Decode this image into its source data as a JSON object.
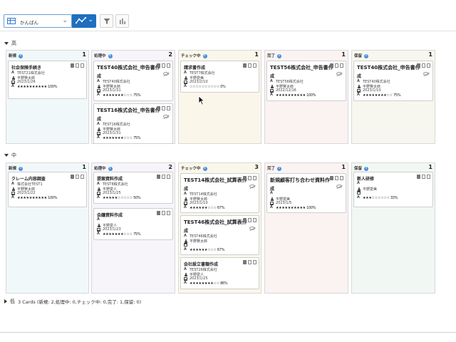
{
  "toolbar": {
    "view_label": "かんばん",
    "icons": [
      "board-icon",
      "line-chart-icon",
      "filter-icon",
      "bar-chart-icon"
    ]
  },
  "groups": [
    {
      "label": "高",
      "expanded": true,
      "columns": [
        {
          "title": "新規",
          "count": "1",
          "bg": "#f1f8f9",
          "cards": [
            {
              "title": "社会保険手続き",
              "lines": [
                "TEST21株式会社",
                "平野賢太郎",
                "2023/1/26"
              ],
              "rating": "★★★★★★★★★★ 100%"
            }
          ]
        },
        {
          "title": "処理中",
          "count": "2",
          "bg": "#f7f4fa",
          "cards": [
            {
              "title": "TEST40株式会社_申告書作",
              "title2": "成",
              "lines": [
                "TEST40株式会社",
                "平野賢太郎",
                "2023/1/31"
              ],
              "rating": "★★★★★★★☆☆☆ 75%"
            },
            {
              "title": "TEST16株式会社_申告書作",
              "title2": "成",
              "lines": [
                "TEST16株式会社",
                "平野賢太郎",
                "2023/1/31"
              ],
              "rating": "★★★★★★★☆☆☆ 75%"
            }
          ]
        },
        {
          "title": "チェック中",
          "count": "1",
          "bg": "#faf7ea",
          "cards": [
            {
              "title": "請求書作成",
              "lines": [
                "TEST7株式会社",
                "平野愛美",
                "2023/2/10"
              ],
              "rating": "☆☆☆☆☆☆☆☆☆☆ 0%"
            }
          ]
        },
        {
          "title": "完了",
          "count": "1",
          "bg": "#fbf2f2",
          "cards": [
            {
              "title": "TEST56株式会社_申告書作",
              "title2": "成",
              "lines": [
                "TEST56株式会社",
                "平野賢太郎",
                "2022/12/16"
              ],
              "rating": "★★★★★★★★★★ 100%"
            }
          ]
        },
        {
          "title": "保留",
          "count": "1",
          "bg": "#f7f7f0",
          "cards": [
            {
              "title": "TEST40株式会社_申告書作",
              "title2": "成",
              "lines": [
                "TEST40株式会社",
                "平野賢太郎",
                "2023/1/10"
              ],
              "rating": "★★★★★★★★☆☆ 75%"
            }
          ]
        }
      ]
    },
    {
      "label": "中",
      "expanded": true,
      "columns": [
        {
          "title": "新規",
          "count": "1",
          "bg": "#f1f8f9",
          "cards": [
            {
              "title": "クレーム内容調査",
              "lines": [
                "株式会社TEST1",
                "平野賢太郎",
                "2023/1/22"
              ],
              "rating": "★★★★★★★★★★ 100%"
            }
          ]
        },
        {
          "title": "処理中",
          "count": "2",
          "bg": "#f7f4fa",
          "cards": [
            {
              "title": "提案資料作成",
              "lines": [
                "TEST8株式会社",
                "平野愛人",
                "2023/1/25"
              ],
              "rating": "★★★★★☆☆☆☆☆ 50%"
            },
            {
              "title": "会議資料作成",
              "lines": [
                "",
                "平野愛人",
                "2023/1/23"
              ],
              "rating": "★★★★★★★☆☆☆ 75%"
            }
          ]
        },
        {
          "title": "チェック中",
          "count": "3",
          "bg": "#faf7ea",
          "cards": [
            {
              "title": "TEST14株式会社_試算表作",
              "title2": "成",
              "lines": [
                "TEST14株式会社",
                "平野賢太郎",
                "2023/1/10"
              ],
              "rating": "★★★★★★☆☆☆ 67%"
            },
            {
              "title": "TEST46株式会社_試算表作",
              "title2": "成",
              "lines": [
                "TEST46株式会社",
                "平野賢太郎",
                ""
              ],
              "rating": "★★★★★★☆☆☆ 67%"
            },
            {
              "title": "会社設立書類作成",
              "lines": [
                "TEST26株式会社",
                "平野愛人",
                "2023/1/25"
              ],
              "rating": "★★★★★★★★☆☆ 86%"
            }
          ]
        },
        {
          "title": "完了",
          "count": "1",
          "bg": "#fbf2f2",
          "cards": [
            {
              "title": "新規顧客打ち合わせ資料作",
              "title2": "成",
              "lines": [
                "",
                "平野愛美",
                "2023/1/5"
              ],
              "rating": "★★★★★★★★★★ 100%"
            }
          ]
        },
        {
          "title": "保留",
          "count": "1",
          "bg": "#f1f8f4",
          "cards": [
            {
              "title": "新人研修",
              "lines": [
                "",
                "平野愛美",
                ""
              ],
              "rating": "★★★☆☆☆☆☆☆ 33%"
            }
          ]
        }
      ]
    },
    {
      "label": "低",
      "expanded": false,
      "summary": "3 Cards (新規: 2,処理中: 0,チェック中: 0,完了: 1,保留: 0)"
    }
  ]
}
